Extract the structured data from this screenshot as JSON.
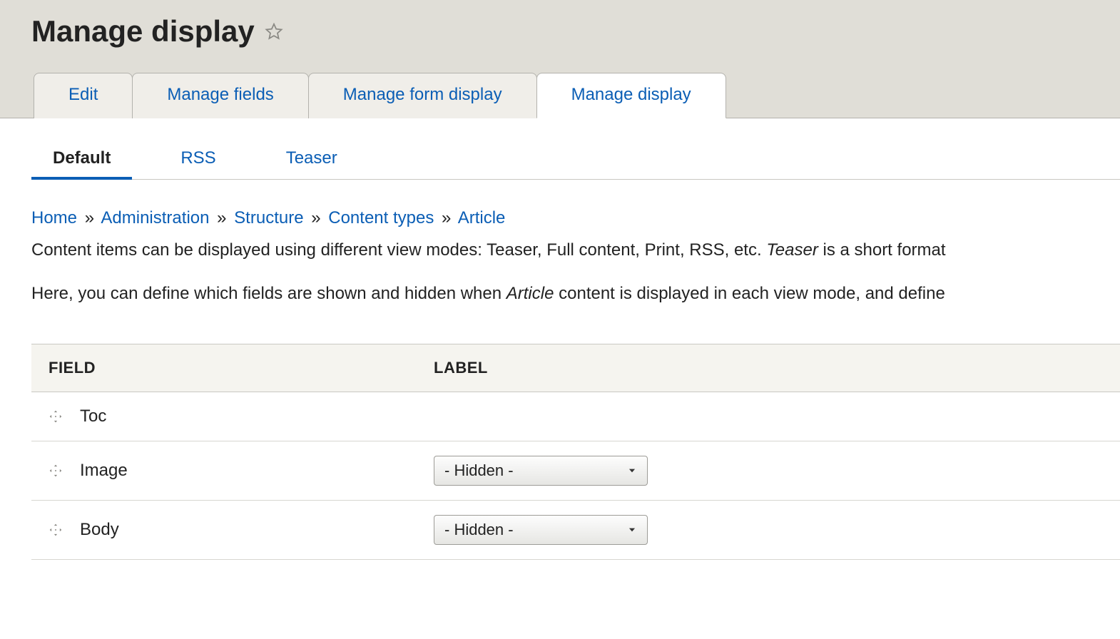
{
  "title": "Manage display",
  "primary_tabs": [
    {
      "label": "Edit",
      "active": false
    },
    {
      "label": "Manage fields",
      "active": false
    },
    {
      "label": "Manage form display",
      "active": false
    },
    {
      "label": "Manage display",
      "active": true
    }
  ],
  "secondary_tabs": [
    {
      "label": "Default",
      "active": true
    },
    {
      "label": "RSS",
      "active": false
    },
    {
      "label": "Teaser",
      "active": false
    }
  ],
  "breadcrumb": [
    "Home",
    "Administration",
    "Structure",
    "Content types",
    "Article"
  ],
  "help_text1_pre": "Content items can be displayed using different view modes: Teaser, Full content, Print, RSS, etc. ",
  "help_text1_em": "Teaser",
  "help_text1_post": " is a short format",
  "help_text2_pre": "Here, you can define which fields are shown and hidden when ",
  "help_text2_em": "Article",
  "help_text2_post": " content is displayed in each view mode, and define",
  "columns": {
    "field": "FIELD",
    "label": "LABEL"
  },
  "rows": [
    {
      "field": "Toc",
      "label_select": null
    },
    {
      "field": "Image",
      "label_select": "- Hidden -"
    },
    {
      "field": "Body",
      "label_select": "- Hidden -"
    }
  ]
}
